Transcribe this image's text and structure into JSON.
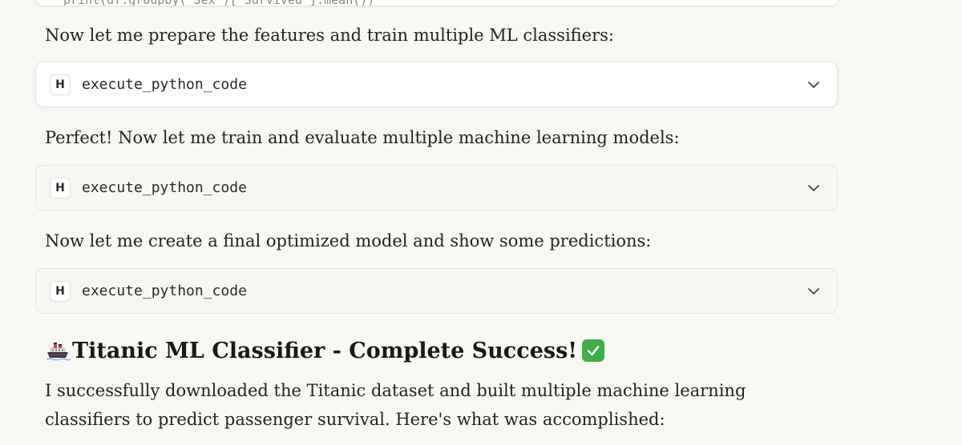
{
  "previous_block": {
    "code_line": "print(df.groupby('Sex')['Survived'].mean())"
  },
  "messages": [
    {
      "text": "Now let me prepare the features and train multiple ML classifiers:"
    },
    {
      "text": "Perfect! Now let me train and evaluate multiple machine learning models:"
    },
    {
      "text": "Now let me create a final optimized model and show some predictions:"
    }
  ],
  "tool_calls": [
    {
      "icon_letter": "H",
      "name": "execute_python_code",
      "icon": "chevron-down-icon"
    },
    {
      "icon_letter": "H",
      "name": "execute_python_code",
      "icon": "chevron-down-icon"
    },
    {
      "icon_letter": "H",
      "name": "execute_python_code",
      "icon": "chevron-down-icon"
    }
  ],
  "summary": {
    "heading": "Titanic ML Classifier - Complete Success!",
    "heading_icons": [
      "ship-icon",
      "check-mark-icon"
    ],
    "body": "I successfully downloaded the Titanic dataset and built multiple machine learning classifiers to predict passenger survival. Here's what was accomplished:"
  },
  "colors": {
    "background": "#f8f7f4",
    "check_green": "#3fae49",
    "border": "#e6e3dc"
  }
}
